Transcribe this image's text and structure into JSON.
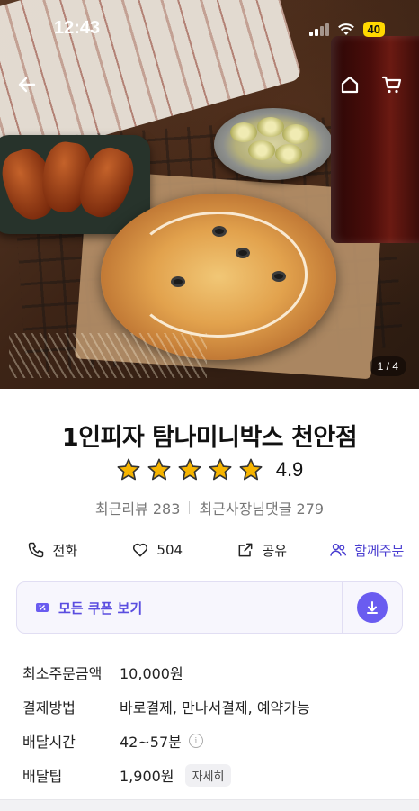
{
  "status_bar": {
    "time": "12:43",
    "battery": "40"
  },
  "hero": {
    "page_indicator": "1 / 4"
  },
  "store": {
    "name": "1인피자 탐나미니박스 천안점",
    "rating": "4.9",
    "stars": 5,
    "recent_reviews_label": "최근리뷰 283",
    "owner_replies_label": "최근사장님댓글 279"
  },
  "actions": {
    "call": "전화",
    "like_count": "504",
    "share": "공유",
    "group_order": "함께주문"
  },
  "coupon": {
    "label": "모든 쿠폰 보기"
  },
  "info": [
    {
      "label": "최소주문금액",
      "value": "10,000원"
    },
    {
      "label": "결제방법",
      "value": "바로결제, 만나서결제, 예약가능"
    },
    {
      "label": "배달시간",
      "value": "42~57분"
    },
    {
      "label": "배달팁",
      "value": "1,900원",
      "chip": "자세히"
    }
  ],
  "colors": {
    "accent": "#5a4de0",
    "star": "#f6b400"
  }
}
